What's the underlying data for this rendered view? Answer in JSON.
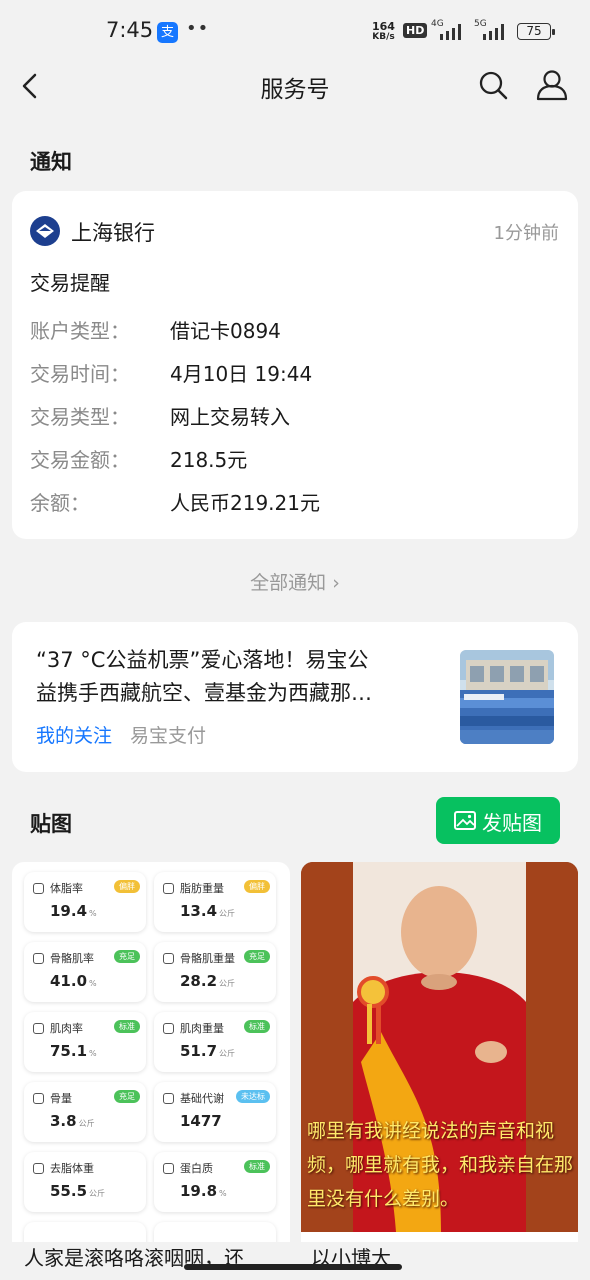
{
  "status_bar": {
    "time": "7:45",
    "alipay_badge": "支",
    "dots": "••",
    "net_speed_value": "164",
    "net_speed_unit": "KB/s",
    "hd": "HD",
    "signal1_label": "4G",
    "signal2_label": "5G",
    "battery": "75"
  },
  "header": {
    "title": "服务号"
  },
  "notice_section": {
    "title": "通知",
    "card": {
      "bank_name": "上海银行",
      "time": "1分钟前",
      "heading": "交易提醒",
      "rows": [
        {
          "key": "账户类型：",
          "value": "借记卡0894"
        },
        {
          "key": "交易时间：",
          "value": "4月10日 19:44"
        },
        {
          "key": "交易类型：",
          "value": "网上交易转入"
        },
        {
          "key": "交易金额：",
          "value": "218.5元"
        },
        {
          "key": "余额：",
          "value": "人民币219.21元"
        }
      ]
    },
    "all_link": "全部通知 ›"
  },
  "article": {
    "title_line1": "“37 °C公益机票”爱心落地！易宝公",
    "title_line2": "益携手西藏航空、壹基金为西藏那…",
    "tag": "我的关注",
    "source": "易宝支付"
  },
  "sticker_section": {
    "title": "贴图",
    "post_button": "发贴图",
    "metrics": [
      {
        "label": "体脂率",
        "value": "19.4",
        "unit": "%",
        "badge": "偏胖",
        "badge_color": "#f2c037"
      },
      {
        "label": "脂肪重量",
        "value": "13.4",
        "unit": "公斤",
        "badge": "偏胖",
        "badge_color": "#f2c037"
      },
      {
        "label": "骨骼肌率",
        "value": "41.0",
        "unit": "%",
        "badge": "充足",
        "badge_color": "#4cc25a"
      },
      {
        "label": "骨骼肌重量",
        "value": "28.2",
        "unit": "公斤",
        "badge": "充足",
        "badge_color": "#4cc25a"
      },
      {
        "label": "肌肉率",
        "value": "75.1",
        "unit": "%",
        "badge": "标准",
        "badge_color": "#4cc25a"
      },
      {
        "label": "肌肉重量",
        "value": "51.7",
        "unit": "公斤",
        "badge": "标准",
        "badge_color": "#4cc25a"
      },
      {
        "label": "骨量",
        "value": "3.8",
        "unit": "公斤",
        "badge": "充足",
        "badge_color": "#4cc25a"
      },
      {
        "label": "基础代谢",
        "value": "1477",
        "unit": "",
        "badge": "未达标",
        "badge_color": "#5bc0f0"
      },
      {
        "label": "去脂体重",
        "value": "55.5",
        "unit": "公斤",
        "badge": "",
        "badge_color": ""
      },
      {
        "label": "蛋白质",
        "value": "19.8",
        "unit": "%",
        "badge": "标准",
        "badge_color": "#4cc25a"
      }
    ],
    "overlay_text": "哪里有我讲经说法的声音和视频，哪里就有我，和我亲自在那里没有什么差别。",
    "left_caption": "人家是滚咯咯滚咽咽，还",
    "right_caption": "以小博大"
  },
  "colors": {
    "accent_green": "#07c160",
    "link_blue": "#1677ff",
    "background": "#f2f2f2"
  }
}
